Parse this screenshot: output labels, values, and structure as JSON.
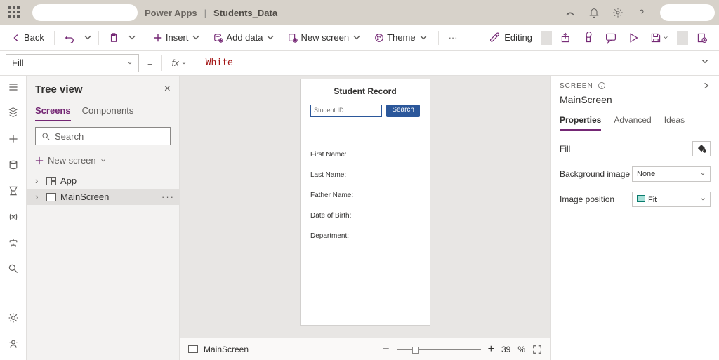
{
  "titlebar": {
    "app_name": "Power Apps",
    "separator": "|",
    "doc_name": "Students_Data"
  },
  "cmdbar": {
    "back": "Back",
    "insert": "Insert",
    "add_data": "Add data",
    "new_screen": "New screen",
    "theme": "Theme",
    "editing": "Editing"
  },
  "formula": {
    "property": "Fill",
    "fx": "fx",
    "value": "White"
  },
  "treeview": {
    "title": "Tree view",
    "tabs": {
      "screens": "Screens",
      "components": "Components"
    },
    "search_placeholder": "Search",
    "new_screen": "New screen",
    "items": [
      "App",
      "MainScreen"
    ]
  },
  "canvas": {
    "title": "Student Record",
    "input_placeholder": "Student ID",
    "button": "Search",
    "labels": [
      "First Name:",
      "Last Name:",
      "Father Name:",
      "Date of Birth:",
      "Department:"
    ]
  },
  "zoombar": {
    "selected": "MainScreen",
    "zoom": "39",
    "pct": "%"
  },
  "rightpanel": {
    "header": "SCREEN",
    "name": "MainScreen",
    "tabs": {
      "properties": "Properties",
      "advanced": "Advanced",
      "ideas": "Ideas"
    },
    "fill_label": "Fill",
    "bg_image_label": "Background image",
    "bg_image_value": "None",
    "img_pos_label": "Image position",
    "img_pos_value": "Fit"
  }
}
